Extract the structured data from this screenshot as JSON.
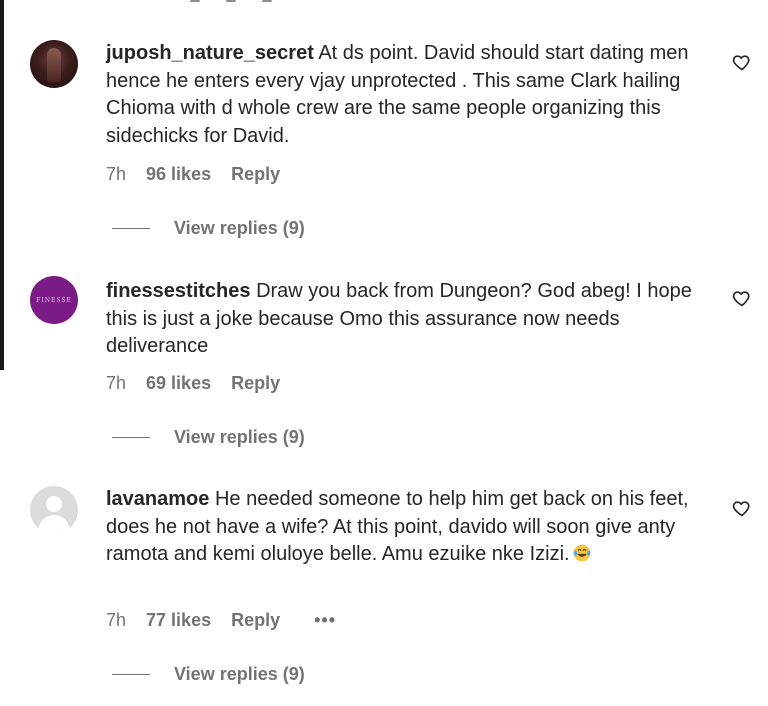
{
  "comments": [
    {
      "username": "juposh_nature_secret",
      "text": "At ds point. David should start dating men hence he enters every vjay unprotected . This same Clark hailing Chioma with d whole crew are the same people organizing this sidechicks for David.",
      "time": "7h",
      "likes": "96 likes",
      "reply": "Reply",
      "view_replies": "View replies (9)",
      "avatar": "profile-photo"
    },
    {
      "username": "finessestitches",
      "text": "Draw you back from Dungeon? God abeg! I hope this is just a joke because Omo this assurance now needs deliverance",
      "time": "7h",
      "likes": "69 likes",
      "reply": "Reply",
      "view_replies": "View replies (9)",
      "avatar": "brand-logo",
      "avatar_text": "FINESSE"
    },
    {
      "username": "lavanamoe",
      "text": "He needed someone to help him get back on his feet, does he not have a wife? At this point, davido will soon give anty ramota and kemi oluloye belle. Amu ezuike nke Izizi.",
      "time": "7h",
      "likes": "77 likes",
      "reply": "Reply",
      "more": "•••",
      "view_replies": "View replies (9)",
      "avatar": "default-avatar",
      "emoji": "laughing-tears-emoji"
    }
  ],
  "icons": {
    "like": "heart-icon"
  },
  "colors": {
    "text": "#262626",
    "secondary": "#737373",
    "brand_avatar": "#7b1b86"
  }
}
